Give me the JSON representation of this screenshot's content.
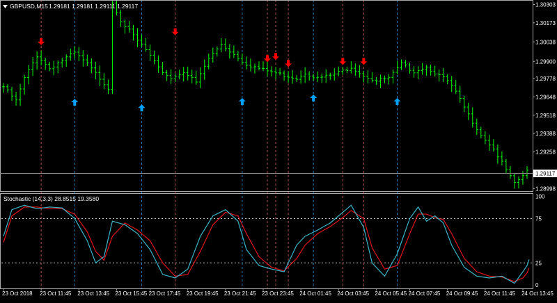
{
  "window": {
    "title": "GBPUSD,M15",
    "ohlc": "1.29181 1.29181 1.29111 1.29117",
    "menu_icon": "triangle-down-icon"
  },
  "price_axis": {
    "labels": [
      "1.30303",
      "1.30173",
      "1.30038",
      "1.29900",
      "1.29778",
      "1.29648",
      "1.29518",
      "1.29388",
      "1.29258",
      "1.28998"
    ],
    "current_price": "1.29117",
    "ylim": [
      1.28985,
      1.30325
    ]
  },
  "indicator": {
    "title": "Stochastic (14,3,3) 28.8515 19.3580",
    "levels": [
      "100",
      "75",
      "25",
      "0"
    ],
    "ylim": [
      -3,
      102
    ],
    "main_color": "#3ab5c8",
    "signal_color": "#e0161a"
  },
  "time_axis": {
    "labels": [
      "23 Oct 2018",
      "23 Oct 11:45",
      "23 Oct 13:45",
      "23 Oct 15:45",
      "23 Oct 17:45",
      "23 Oct 19:45",
      "23 Oct 21:45",
      "23 Oct 23:45",
      "24 Oct 01:45",
      "24 Oct 03:45",
      "24 Oct 05:45",
      "24 Oct 07:45",
      "24 Oct 09:45",
      "24 Oct 11:45",
      "24 Oct 13:45"
    ]
  },
  "colors": {
    "background": "#000000",
    "candle": "#00ff00",
    "grid_text": "#ffffff",
    "sell_arrow": "#ff0000",
    "buy_arrow": "#00a2ff",
    "sell_line": "#b05050",
    "buy_line": "#1e7bb5"
  },
  "chart_data": {
    "type": "ohlc",
    "bars": 126,
    "price_path": [
      [
        0,
        1.2972
      ],
      [
        3,
        1.2962
      ],
      [
        5,
        1.2978
      ],
      [
        8,
        1.2994
      ],
      [
        11,
        1.2985
      ],
      [
        14,
        1.2991
      ],
      [
        17,
        1.2996
      ],
      [
        20,
        1.2988
      ],
      [
        23,
        1.2978
      ],
      [
        25,
        1.2971
      ],
      [
        26,
        1.3032
      ],
      [
        28,
        1.3019
      ],
      [
        31,
        1.3008
      ],
      [
        34,
        1.2998
      ],
      [
        37,
        1.2985
      ],
      [
        40,
        1.2978
      ],
      [
        43,
        1.2983
      ],
      [
        46,
        1.2975
      ],
      [
        49,
        1.2992
      ],
      [
        52,
        1.3002
      ],
      [
        55,
        1.2995
      ],
      [
        58,
        1.2988
      ],
      [
        62,
        1.2984
      ],
      [
        66,
        1.2981
      ],
      [
        70,
        1.2978
      ],
      [
        72,
        1.2982
      ],
      [
        75,
        1.2978
      ],
      [
        78,
        1.298
      ],
      [
        80,
        1.2982
      ],
      [
        83,
        1.2986
      ],
      [
        86,
        1.298
      ],
      [
        89,
        1.2976
      ],
      [
        92,
        1.2978
      ],
      [
        95,
        1.2988
      ],
      [
        98,
        1.2983
      ],
      [
        101,
        1.2986
      ],
      [
        103,
        1.2982
      ],
      [
        106,
        1.2976
      ],
      [
        108,
        1.2968
      ],
      [
        111,
        1.2952
      ],
      [
        114,
        1.2938
      ],
      [
        117,
        1.2928
      ],
      [
        119,
        1.2918
      ],
      [
        122,
        1.2903
      ],
      [
        125,
        1.2912
      ]
    ],
    "sell_signals": [
      {
        "label": "23 Oct 11:45",
        "price": 1.3002
      },
      {
        "label": "23 Oct 19:45",
        "price": 1.3009
      },
      {
        "label": "24 Oct 01:15",
        "price": 1.299
      },
      {
        "label": "24 Oct 01:45",
        "price": 1.29915
      },
      {
        "label": "24 Oct 02:30",
        "price": 1.29865
      },
      {
        "label": "24 Oct 05:45",
        "price": 1.2988
      },
      {
        "label": "24 Oct 07:00",
        "price": 1.2988
      }
    ],
    "buy_signals": [
      {
        "label": "23 Oct 13:45",
        "price": 1.2963
      },
      {
        "label": "23 Oct 17:45",
        "price": 1.2959
      },
      {
        "label": "23 Oct 23:45",
        "price": 1.29635
      },
      {
        "label": "24 Oct 04:00",
        "price": 1.2966
      },
      {
        "label": "24 Oct 09:00",
        "price": 1.29635
      }
    ],
    "stochastic_main": [
      [
        0,
        55
      ],
      [
        2,
        85
      ],
      [
        5,
        90
      ],
      [
        8,
        86
      ],
      [
        11,
        88
      ],
      [
        14,
        87
      ],
      [
        17,
        75
      ],
      [
        20,
        50
      ],
      [
        22,
        25
      ],
      [
        24,
        32
      ],
      [
        26,
        72
      ],
      [
        29,
        68
      ],
      [
        32,
        58
      ],
      [
        35,
        40
      ],
      [
        38,
        12
      ],
      [
        41,
        8
      ],
      [
        44,
        18
      ],
      [
        47,
        55
      ],
      [
        50,
        78
      ],
      [
        53,
        85
      ],
      [
        56,
        72
      ],
      [
        58,
        40
      ],
      [
        61,
        22
      ],
      [
        64,
        18
      ],
      [
        67,
        15
      ],
      [
        70,
        45
      ],
      [
        72,
        55
      ],
      [
        75,
        62
      ],
      [
        78,
        70
      ],
      [
        81,
        82
      ],
      [
        83,
        90
      ],
      [
        86,
        65
      ],
      [
        88,
        25
      ],
      [
        91,
        10
      ],
      [
        94,
        35
      ],
      [
        97,
        75
      ],
      [
        99,
        88
      ],
      [
        101,
        72
      ],
      [
        103,
        78
      ],
      [
        105,
        70
      ],
      [
        107,
        45
      ],
      [
        110,
        20
      ],
      [
        113,
        10
      ],
      [
        116,
        8
      ],
      [
        119,
        10
      ],
      [
        122,
        2
      ],
      [
        124,
        15
      ],
      [
        126,
        28.85
      ]
    ],
    "stochastic_signal": [
      [
        0,
        48
      ],
      [
        2,
        78
      ],
      [
        5,
        88
      ],
      [
        8,
        88
      ],
      [
        11,
        86
      ],
      [
        14,
        86
      ],
      [
        17,
        80
      ],
      [
        20,
        60
      ],
      [
        22,
        38
      ],
      [
        24,
        28
      ],
      [
        26,
        55
      ],
      [
        29,
        70
      ],
      [
        32,
        62
      ],
      [
        35,
        50
      ],
      [
        38,
        25
      ],
      [
        41,
        10
      ],
      [
        44,
        12
      ],
      [
        47,
        38
      ],
      [
        50,
        68
      ],
      [
        53,
        82
      ],
      [
        56,
        78
      ],
      [
        58,
        58
      ],
      [
        61,
        32
      ],
      [
        64,
        20
      ],
      [
        67,
        16
      ],
      [
        70,
        30
      ],
      [
        72,
        45
      ],
      [
        75,
        58
      ],
      [
        78,
        66
      ],
      [
        81,
        76
      ],
      [
        83,
        84
      ],
      [
        86,
        75
      ],
      [
        88,
        42
      ],
      [
        91,
        18
      ],
      [
        94,
        22
      ],
      [
        97,
        58
      ],
      [
        99,
        80
      ],
      [
        101,
        80
      ],
      [
        103,
        76
      ],
      [
        105,
        74
      ],
      [
        107,
        58
      ],
      [
        110,
        30
      ],
      [
        113,
        15
      ],
      [
        116,
        10
      ],
      [
        119,
        9
      ],
      [
        122,
        4
      ],
      [
        124,
        8
      ],
      [
        126,
        19.358
      ]
    ]
  }
}
